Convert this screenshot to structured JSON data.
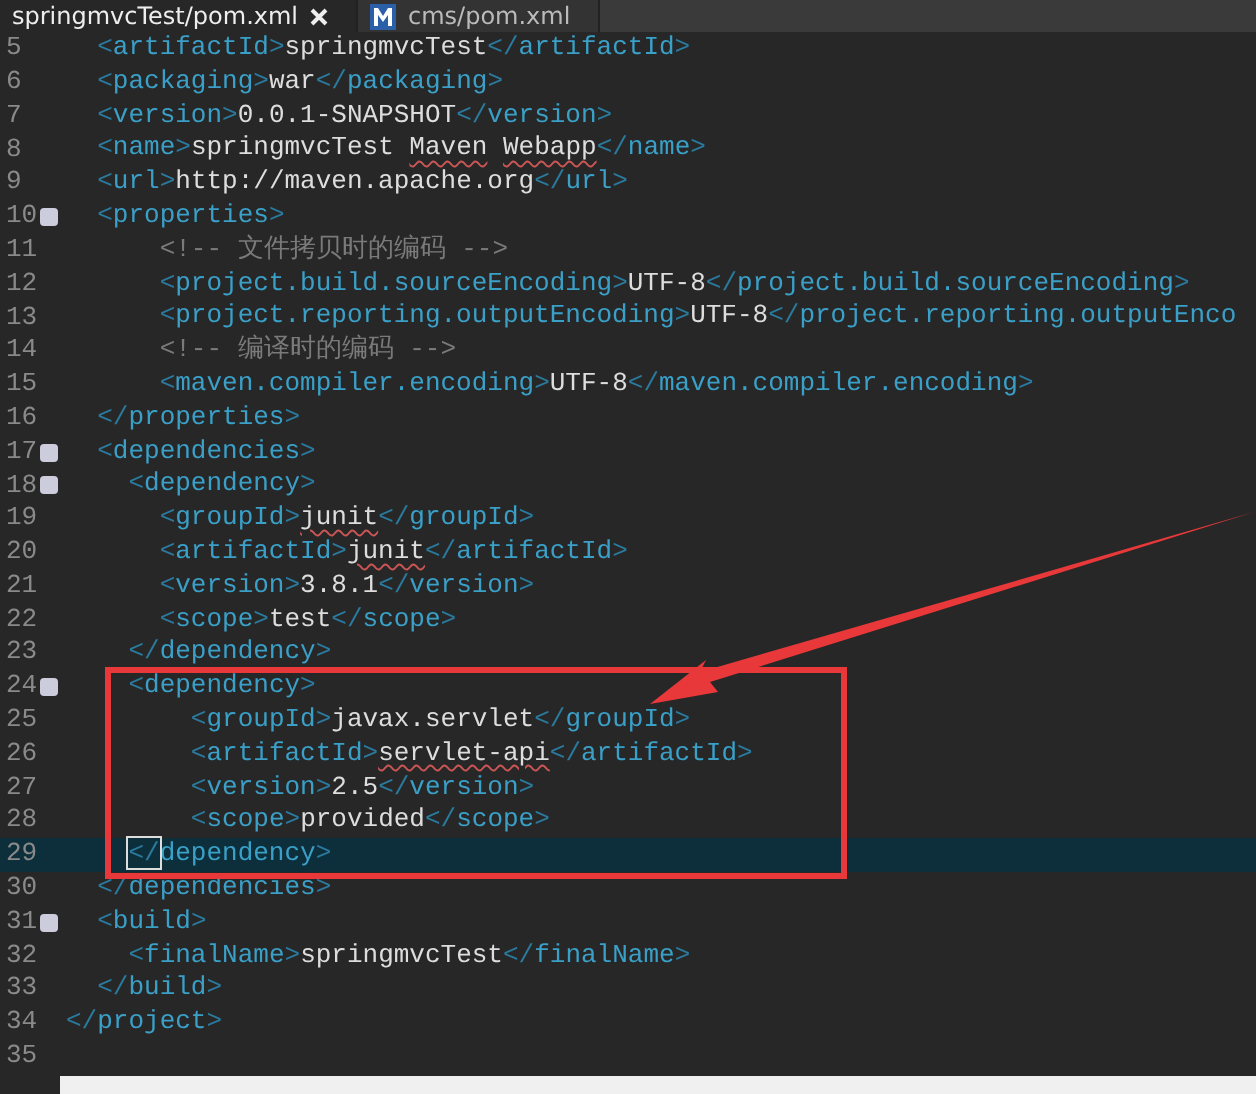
{
  "tabs": [
    {
      "label": "springmvcTest/pom.xml",
      "selected": true
    },
    {
      "label": "cms/pom.xml",
      "selected": false
    }
  ],
  "lines": [
    {
      "number": "5",
      "fold": false,
      "current": false,
      "tokens": [
        {
          "kind": "tag",
          "text": "  <artifactId>"
        },
        {
          "kind": "text",
          "text": "springmvcTest"
        },
        {
          "kind": "tag",
          "text": "</artifactId>"
        }
      ]
    },
    {
      "number": "6",
      "fold": false,
      "current": false,
      "tokens": [
        {
          "kind": "tag",
          "text": "  <packaging>"
        },
        {
          "kind": "text",
          "text": "war"
        },
        {
          "kind": "tag",
          "text": "</packaging>"
        }
      ]
    },
    {
      "number": "7",
      "fold": false,
      "current": false,
      "tokens": [
        {
          "kind": "tag",
          "text": "  <version>"
        },
        {
          "kind": "text",
          "text": "0.0.1-SNAPSHOT"
        },
        {
          "kind": "tag",
          "text": "</version>"
        }
      ]
    },
    {
      "number": "8",
      "fold": false,
      "current": false,
      "tokens": [
        {
          "kind": "tag",
          "text": "  <name>"
        },
        {
          "kind": "text",
          "text": "springmvcTest "
        },
        {
          "kind": "text",
          "text": "Maven",
          "misspelled": true
        },
        {
          "kind": "text",
          "text": " Webapp",
          "misspelled": true
        },
        {
          "kind": "tag",
          "text": "</name>"
        }
      ]
    },
    {
      "number": "9",
      "fold": false,
      "current": false,
      "tokens": [
        {
          "kind": "tag",
          "text": "  <url>"
        },
        {
          "kind": "text",
          "text": "http://maven.apache.org"
        },
        {
          "kind": "tag",
          "text": "</url>"
        }
      ]
    },
    {
      "number": "10",
      "fold": true,
      "current": false,
      "tokens": [
        {
          "kind": "tag",
          "text": "  <properties>"
        }
      ]
    },
    {
      "number": "11",
      "fold": false,
      "current": false,
      "tokens": [
        {
          "kind": "comment",
          "text": "      <!-- 文件拷贝时的编码 -->"
        }
      ]
    },
    {
      "number": "12",
      "fold": false,
      "current": false,
      "tokens": [
        {
          "kind": "tag",
          "text": "      <project.build.sourceEncoding>"
        },
        {
          "kind": "text",
          "text": "UTF-8"
        },
        {
          "kind": "tag",
          "text": "</project.build.sourceEncoding>"
        }
      ]
    },
    {
      "number": "13",
      "fold": false,
      "current": false,
      "tokens": [
        {
          "kind": "tag",
          "text": "      <project.reporting.outputEncoding>"
        },
        {
          "kind": "text",
          "text": "UTF-8"
        },
        {
          "kind": "tag",
          "text": "</project.reporting.outputEnco"
        }
      ]
    },
    {
      "number": "14",
      "fold": false,
      "current": false,
      "tokens": [
        {
          "kind": "comment",
          "text": "      <!-- 编译时的编码 -->"
        }
      ]
    },
    {
      "number": "15",
      "fold": false,
      "current": false,
      "tokens": [
        {
          "kind": "tag",
          "text": "      <maven.compiler.encoding>"
        },
        {
          "kind": "text",
          "text": "UTF-8"
        },
        {
          "kind": "tag",
          "text": "</maven.compiler.encoding>"
        }
      ]
    },
    {
      "number": "16",
      "fold": false,
      "current": false,
      "tokens": [
        {
          "kind": "tag",
          "text": "  </properties>"
        }
      ]
    },
    {
      "number": "17",
      "fold": true,
      "current": false,
      "tokens": [
        {
          "kind": "tag",
          "text": "  <dependencies>"
        }
      ]
    },
    {
      "number": "18",
      "fold": true,
      "current": false,
      "tokens": [
        {
          "kind": "tag",
          "text": "    <dependency>"
        }
      ]
    },
    {
      "number": "19",
      "fold": false,
      "current": false,
      "tokens": [
        {
          "kind": "tag",
          "text": "      <groupId>"
        },
        {
          "kind": "text",
          "text": "junit",
          "misspelled": true
        },
        {
          "kind": "tag",
          "text": "</groupId>"
        }
      ]
    },
    {
      "number": "20",
      "fold": false,
      "current": false,
      "tokens": [
        {
          "kind": "tag",
          "text": "      <artifactId>"
        },
        {
          "kind": "text",
          "text": "junit",
          "misspelled": true
        },
        {
          "kind": "tag",
          "text": "</artifactId>"
        }
      ]
    },
    {
      "number": "21",
      "fold": false,
      "current": false,
      "tokens": [
        {
          "kind": "tag",
          "text": "      <version>"
        },
        {
          "kind": "text",
          "text": "3.8.1"
        },
        {
          "kind": "tag",
          "text": "</version>"
        }
      ]
    },
    {
      "number": "22",
      "fold": false,
      "current": false,
      "tokens": [
        {
          "kind": "tag",
          "text": "      <scope>"
        },
        {
          "kind": "text",
          "text": "test"
        },
        {
          "kind": "tag",
          "text": "</scope>"
        }
      ]
    },
    {
      "number": "23",
      "fold": false,
      "current": false,
      "tokens": [
        {
          "kind": "tag",
          "text": "    </dependency>"
        }
      ]
    },
    {
      "number": "24",
      "fold": true,
      "current": false,
      "tokens": [
        {
          "kind": "tag",
          "text": "    <dependency>"
        }
      ]
    },
    {
      "number": "25",
      "fold": false,
      "current": false,
      "tokens": [
        {
          "kind": "tag",
          "text": "        <groupId>"
        },
        {
          "kind": "text",
          "text": "javax.servlet"
        },
        {
          "kind": "tag",
          "text": "</groupId>"
        }
      ]
    },
    {
      "number": "26",
      "fold": false,
      "current": false,
      "tokens": [
        {
          "kind": "tag",
          "text": "        <artifactId>"
        },
        {
          "kind": "text",
          "text": "servlet-api",
          "misspelled": true
        },
        {
          "kind": "tag",
          "text": "</artifactId>"
        }
      ]
    },
    {
      "number": "27",
      "fold": false,
      "current": false,
      "tokens": [
        {
          "kind": "tag",
          "text": "        <version>"
        },
        {
          "kind": "text",
          "text": "2.5"
        },
        {
          "kind": "tag",
          "text": "</version>"
        }
      ]
    },
    {
      "number": "28",
      "fold": false,
      "current": false,
      "tokens": [
        {
          "kind": "tag",
          "text": "        <scope>"
        },
        {
          "kind": "text",
          "text": "provided"
        },
        {
          "kind": "tag",
          "text": "</scope>"
        }
      ]
    },
    {
      "number": "29",
      "fold": false,
      "current": true,
      "tokens": [
        {
          "kind": "tag",
          "text": "    </dependency>"
        }
      ]
    },
    {
      "number": "30",
      "fold": false,
      "current": false,
      "tokens": [
        {
          "kind": "tag",
          "text": "  </dependencies>"
        }
      ]
    },
    {
      "number": "31",
      "fold": true,
      "current": false,
      "tokens": [
        {
          "kind": "tag",
          "text": "  <build>"
        }
      ]
    },
    {
      "number": "32",
      "fold": false,
      "current": false,
      "tokens": [
        {
          "kind": "tag",
          "text": "    <finalName>"
        },
        {
          "kind": "text",
          "text": "springmvcTest"
        },
        {
          "kind": "tag",
          "text": "</finalName>"
        }
      ]
    },
    {
      "number": "33",
      "fold": false,
      "current": false,
      "tokens": [
        {
          "kind": "tag",
          "text": "  </build>"
        }
      ]
    },
    {
      "number": "34",
      "fold": false,
      "current": false,
      "tokens": [
        {
          "kind": "tag",
          "text": "</project>"
        }
      ]
    },
    {
      "number": "35",
      "fold": false,
      "current": false
    }
  ]
}
